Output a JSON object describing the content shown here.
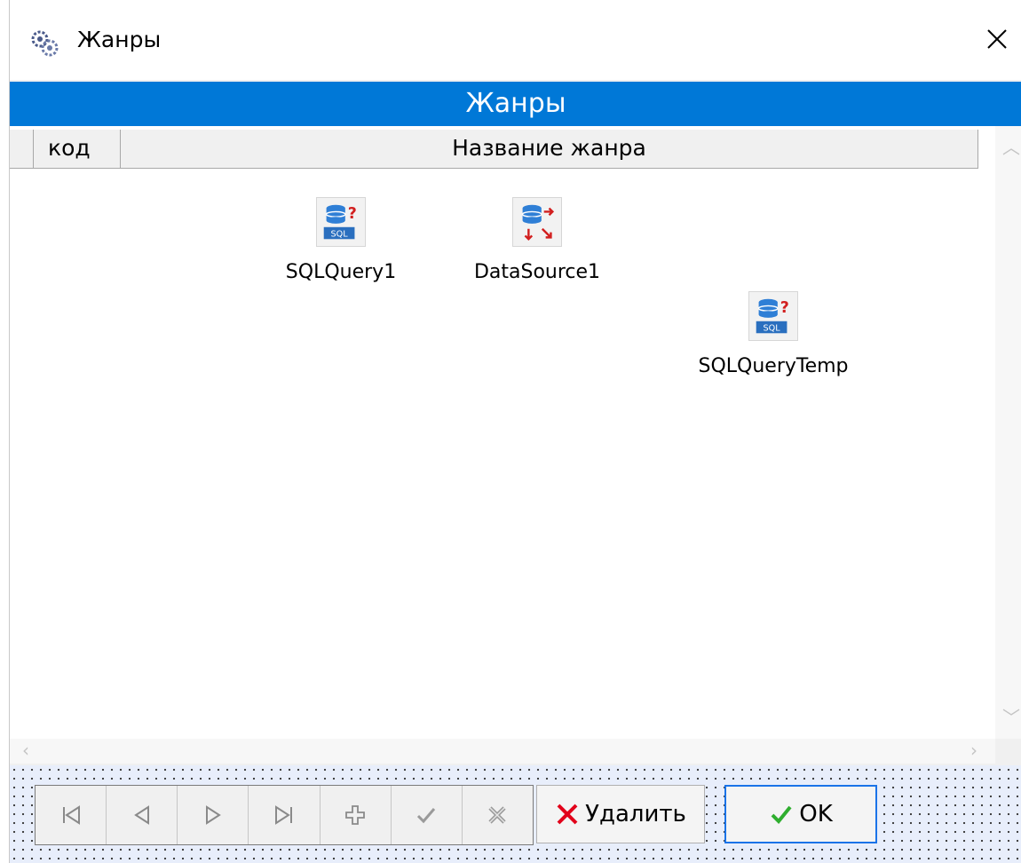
{
  "window": {
    "title": "Жанры",
    "icon": "gear-cluster-icon"
  },
  "banner": {
    "caption": "Жанры"
  },
  "grid": {
    "columns": [
      {
        "label": "код"
      },
      {
        "label": "Название жанра"
      }
    ],
    "rows": []
  },
  "components": [
    {
      "label": "SQLQuery1",
      "icon": "sql-query-icon"
    },
    {
      "label": "DataSource1",
      "icon": "datasource-icon"
    },
    {
      "label": "SQLQueryTemp",
      "icon": "sql-query-icon"
    }
  ],
  "navigator": {
    "buttons": [
      {
        "icon": "first-record-icon"
      },
      {
        "icon": "prior-record-icon"
      },
      {
        "icon": "next-record-icon"
      },
      {
        "icon": "last-record-icon"
      },
      {
        "icon": "insert-record-icon"
      },
      {
        "icon": "post-record-icon"
      },
      {
        "icon": "cancel-record-icon"
      }
    ]
  },
  "buttons": {
    "delete_label": "Удалить",
    "ok_label": "OK"
  },
  "colors": {
    "banner": "#0078d7",
    "ok_border": "#1a73e8",
    "delete_icon": "#e2001a",
    "ok_icon": "#2fae2f",
    "toolbar_bg": "#e8eefb"
  }
}
